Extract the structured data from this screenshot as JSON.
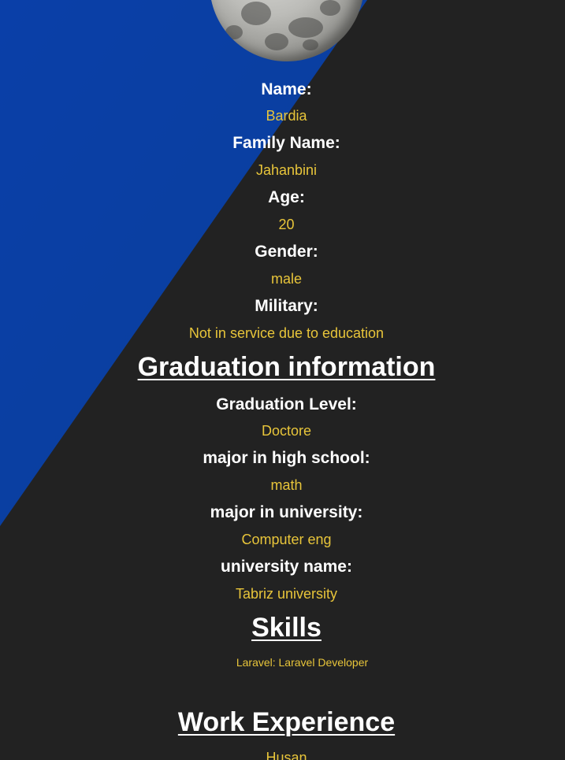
{
  "personal": [
    {
      "label": "Name:",
      "value": "Bardia"
    },
    {
      "label": "Family Name:",
      "value": "Jahanbini"
    },
    {
      "label": "Age:",
      "value": "20"
    },
    {
      "label": "Gender:",
      "value": "male"
    },
    {
      "label": "Military:",
      "value": "Not in service due to education"
    }
  ],
  "graduation": {
    "title": "Graduation information",
    "fields": [
      {
        "label": "Graduation Level:",
        "value": "Doctore"
      },
      {
        "label": "major in high school:",
        "value": "math"
      },
      {
        "label": "major in university:",
        "value": "Computer eng"
      },
      {
        "label": "university name:",
        "value": "Tabriz university"
      }
    ]
  },
  "skills": {
    "title": "Skills",
    "items": [
      "Laravel: Laravel Developer"
    ]
  },
  "work": {
    "title": "Work Experience",
    "items": [
      "Husan"
    ]
  },
  "colors": {
    "background": "#222222",
    "accent_blue": "#0a3fa8",
    "label": "#ffffff",
    "value": "#e8c53a"
  }
}
